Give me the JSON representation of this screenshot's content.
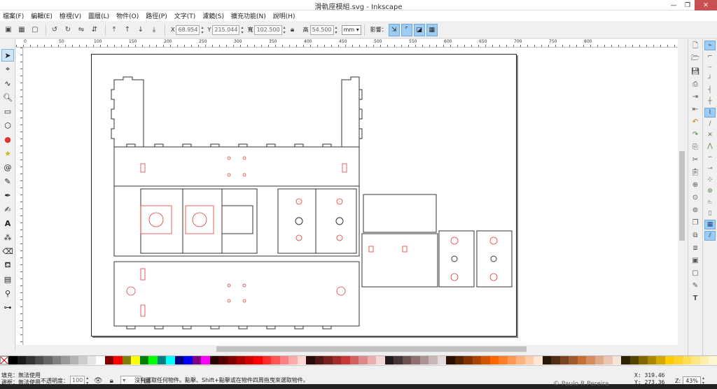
{
  "window": {
    "title": "滑軌座模組.svg - Inkscape",
    "minimize": "—",
    "maximize": "❐",
    "close": "✕"
  },
  "menu": [
    "檔案(F)",
    "編輯(E)",
    "檢視(V)",
    "圖層(L)",
    "物件(O)",
    "路徑(P)",
    "文字(T)",
    "濾鏡(S)",
    "擴充功能(N)",
    "說明(H)"
  ],
  "toolbar": {
    "x_label": "X",
    "x_value": "68.954",
    "y_label": "Y",
    "y_value": "215.044",
    "w_label": "寬",
    "w_value": "102.500",
    "h_label": "高",
    "h_value": "54.500",
    "unit": "mm",
    "affect_label": "影響："
  },
  "ruler_ticks": [
    "0",
    "50",
    "100",
    "150",
    "200",
    "250",
    "300",
    "350",
    "400",
    "450",
    "500",
    "550",
    "600",
    "650",
    "700",
    "750",
    "800"
  ],
  "status": {
    "fill_label": "填充：",
    "fill_value": "無法使用",
    "stroke_label": "邊框：",
    "stroke_value": "無法使用",
    "opacity_label": "不透明度：",
    "opacity_value": "100",
    "message": "沒有選取任何物件。點擊、Shift+點擊或在物件四周拖曳來選取物件。",
    "x_label": "X:",
    "x_value": "319.46",
    "y_label": "Y:",
    "y_value": "273.36",
    "zoom_label": "Z:",
    "zoom_value": "43%"
  },
  "overlay_text": "© Paulo R Pereira",
  "palette_colors": [
    "#000000",
    "#1a1a1a",
    "#333333",
    "#4d4d4d",
    "#666666",
    "#808080",
    "#999999",
    "#b3b3b3",
    "#cccccc",
    "#e6e6e6",
    "#ffffff",
    "#800000",
    "#ff0000",
    "#808000",
    "#ffff00",
    "#008000",
    "#00ff00",
    "#008080",
    "#00ffff",
    "#000080",
    "#0000ff",
    "#800080",
    "#ff00ff",
    "#2b0000",
    "#550000",
    "#800000",
    "#aa0000",
    "#d40000",
    "#ff0000",
    "#ff2a2a",
    "#ff5555",
    "#ff8080",
    "#ffaaaa",
    "#ffd5d5",
    "#280b0b",
    "#501616",
    "#782121",
    "#a02c2c",
    "#c83737",
    "#d35f5f",
    "#de8787",
    "#e9afaf",
    "#f4d7d7",
    "#241c1c",
    "#483737",
    "#6c5353",
    "#916f6f",
    "#ac9393",
    "#c8b7b7",
    "#e3dbdb",
    "#2b1100",
    "#552200",
    "#803300",
    "#aa4400",
    "#d45500",
    "#ff6600",
    "#ff7f2a",
    "#ff9955",
    "#ffb380",
    "#ffccaa",
    "#ffe6d5",
    "#28170b",
    "#502d16",
    "#784421",
    "#a05a2c",
    "#c87137",
    "#d38d5f",
    "#deaa87",
    "#e9c6af",
    "#f4e3d7",
    "#2b2200",
    "#554400",
    "#806600",
    "#aa8800",
    "#d4aa00",
    "#ffcc00",
    "#ffd42a",
    "#ffdd55",
    "#ffe680",
    "#ffeeaa",
    "#fff6d5"
  ]
}
